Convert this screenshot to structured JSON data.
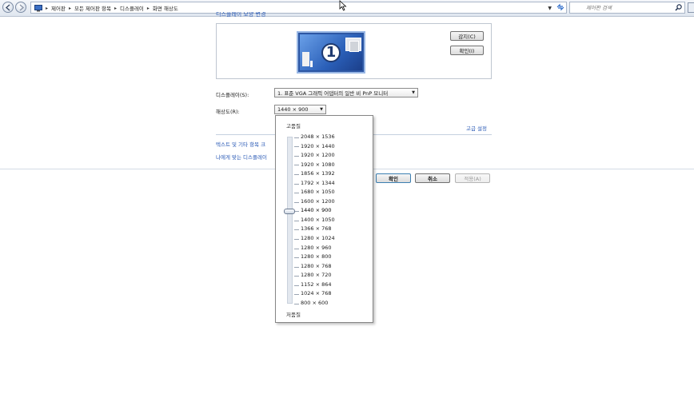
{
  "address_bar": {
    "breadcrumbs": [
      "제어판",
      "모든 제어판 항목",
      "디스플레이",
      "화면 해상도"
    ],
    "search_placeholder": "제어판 검색"
  },
  "page": {
    "heading_partial": "디스플레이 모양 변경",
    "monitor_number": "1"
  },
  "buttons": {
    "detect": "감지(C)",
    "identify": "확인(I)",
    "ok": "확인",
    "cancel": "취소",
    "apply": "적용(A)"
  },
  "form": {
    "display_label": "디스플레이(S):",
    "display_value": "1. 표준 VGA 그래픽 어댑터의 일반 비 PnP 모니터",
    "resolution_label": "해상도(R):",
    "resolution_value": "1440 × 900"
  },
  "links": {
    "advanced": "고급 설정",
    "text_size": "텍스트 및 기타 항목 크",
    "which_display": "나에게 맞는 디스플레이"
  },
  "resolution_dropdown": {
    "high_label": "고품질",
    "low_label": "저품질",
    "selected": "1440 × 900",
    "options": [
      "2048 × 1536",
      "1920 × 1440",
      "1920 × 1200",
      "1920 × 1080",
      "1856 × 1392",
      "1792 × 1344",
      "1680 × 1050",
      "1600 × 1200",
      "1440 × 900",
      "1400 × 1050",
      "1366 × 768",
      "1280 × 1024",
      "1280 × 960",
      "1280 × 800",
      "1280 × 768",
      "1280 × 720",
      "1152 × 864",
      "1024 × 768",
      "800 × 600"
    ]
  }
}
